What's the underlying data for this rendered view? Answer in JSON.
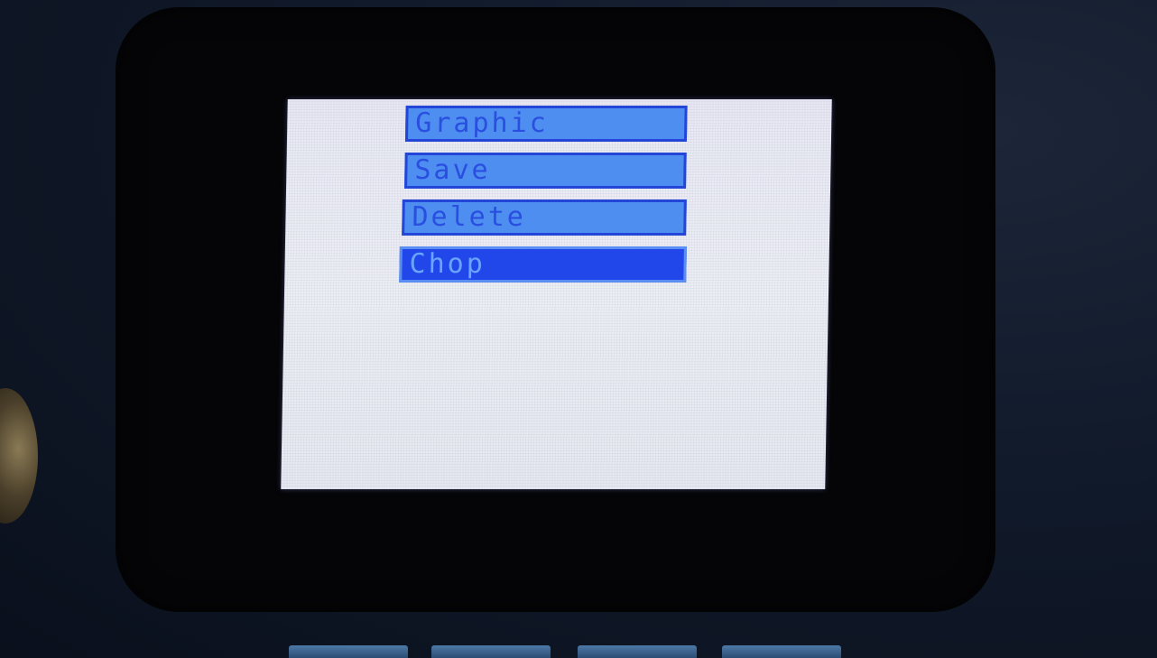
{
  "device_menu": {
    "items": [
      {
        "label": "Graphic",
        "selected": false
      },
      {
        "label": "Save",
        "selected": false
      },
      {
        "label": "Delete",
        "selected": false
      },
      {
        "label": "Chop",
        "selected": true
      }
    ]
  },
  "colors": {
    "item_fill": "#4d8ef0",
    "item_border": "#2346d8",
    "selected_fill": "#2147ea",
    "screen_bg": "#e9ebf4"
  }
}
